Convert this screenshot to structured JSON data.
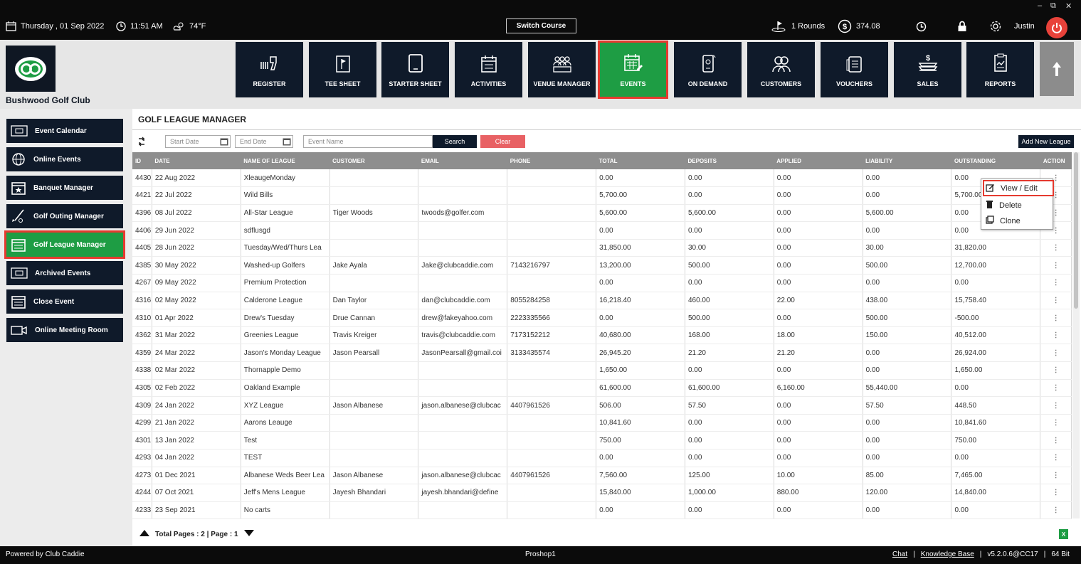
{
  "topbar": {
    "date": "Thursday , 01 Sep 2022",
    "time": "11:51 AM",
    "weather": "74°F",
    "switch_course": "Switch Course",
    "rounds": "1 Rounds",
    "balance": "374.08",
    "user": "Justin"
  },
  "club": {
    "name": "Bushwood Golf Club"
  },
  "nav": [
    {
      "label": "REGISTER",
      "icon": "barcode-scanner-icon"
    },
    {
      "label": "TEE SHEET",
      "icon": "flag-board-icon"
    },
    {
      "label": "STARTER SHEET",
      "icon": "tablet-icon"
    },
    {
      "label": "ACTIVITIES",
      "icon": "calendar-list-icon"
    },
    {
      "label": "VENUE MANAGER",
      "icon": "people-group-icon"
    },
    {
      "label": "EVENTS",
      "icon": "calendar-edit-icon"
    },
    {
      "label": "ON DEMAND",
      "icon": "phone-icon"
    },
    {
      "label": "CUSTOMERS",
      "icon": "customers-icon"
    },
    {
      "label": "VOUCHERS",
      "icon": "voucher-icon"
    },
    {
      "label": "SALES",
      "icon": "cash-icon"
    },
    {
      "label": "REPORTS",
      "icon": "report-icon"
    }
  ],
  "sidebar": [
    {
      "label": "Event Calendar"
    },
    {
      "label": "Online Events"
    },
    {
      "label": "Banquet Manager"
    },
    {
      "label": "Golf Outing Manager"
    },
    {
      "label": "Golf League Manager"
    },
    {
      "label": "Archived Events"
    },
    {
      "label": "Close Event"
    },
    {
      "label": "Online Meeting Room"
    }
  ],
  "main": {
    "title": "GOLF LEAGUE MANAGER",
    "start_placeholder": "Start Date",
    "end_placeholder": "End Date",
    "name_placeholder": "Event Name",
    "search_label": "Search",
    "clear_label": "Clear",
    "add_label": "Add New League",
    "pagination": "Total Pages : 2 | Page : 1",
    "excel": "X"
  },
  "table": {
    "headers": [
      "ID",
      "DATE",
      "NAME OF LEAGUE",
      "CUSTOMER",
      "EMAIL",
      "PHONE",
      "TOTAL",
      "DEPOSITS",
      "APPLIED",
      "LIABILITY",
      "OUTSTANDING",
      "ACTION"
    ],
    "rows": [
      [
        "4430",
        "22 Aug 2022",
        "XleaugeMonday",
        "",
        "",
        "",
        "0.00",
        "0.00",
        "0.00",
        "0.00",
        "0.00",
        "⋮"
      ],
      [
        "4421",
        "22 Jul 2022",
        "Wild Bills",
        "",
        "",
        "",
        "5,700.00",
        "0.00",
        "0.00",
        "0.00",
        "5,700.00",
        "⋮"
      ],
      [
        "4396",
        "08 Jul 2022",
        "All-Star League",
        "Tiger Woods",
        "twoods@golfer.com",
        "",
        "5,600.00",
        "5,600.00",
        "0.00",
        "5,600.00",
        "0.00",
        "⋮"
      ],
      [
        "4406",
        "29 Jun 2022",
        "sdflusgd",
        "",
        "",
        "",
        "0.00",
        "0.00",
        "0.00",
        "0.00",
        "0.00",
        "⋮"
      ],
      [
        "4405",
        "28 Jun 2022",
        "Tuesday/Wed/Thurs Lea",
        "",
        "",
        "",
        "31,850.00",
        "30.00",
        "0.00",
        "30.00",
        "31,820.00",
        "⋮"
      ],
      [
        "4385",
        "30 May 2022",
        "Washed-up Golfers",
        "Jake Ayala",
        "Jake@clubcaddie.com",
        "7143216797",
        "13,200.00",
        "500.00",
        "0.00",
        "500.00",
        "12,700.00",
        "⋮"
      ],
      [
        "4267",
        "09 May 2022",
        "Premium Protection",
        "",
        "",
        "",
        "0.00",
        "0.00",
        "0.00",
        "0.00",
        "0.00",
        "⋮"
      ],
      [
        "4316",
        "02 May 2022",
        "Calderone League",
        "Dan Taylor",
        "dan@clubcaddie.com",
        "8055284258",
        "16,218.40",
        "460.00",
        "22.00",
        "438.00",
        "15,758.40",
        "⋮"
      ],
      [
        "4310",
        "01 Apr 2022",
        "Drew's Tuesday",
        "Drue Cannan",
        "drew@fakeyahoo.com",
        "2223335566",
        "0.00",
        "500.00",
        "0.00",
        "500.00",
        "-500.00",
        "⋮"
      ],
      [
        "4362",
        "31 Mar 2022",
        "Greenies League",
        "Travis Kreiger",
        "travis@clubcaddie.com",
        "7173152212",
        "40,680.00",
        "168.00",
        "18.00",
        "150.00",
        "40,512.00",
        "⋮"
      ],
      [
        "4359",
        "24 Mar 2022",
        "Jason's Monday League",
        "Jason Pearsall",
        "JasonPearsall@gmail.coi",
        "3133435574",
        "26,945.20",
        "21.20",
        "21.20",
        "0.00",
        "26,924.00",
        "⋮"
      ],
      [
        "4338",
        "02 Mar 2022",
        "Thornapple Demo",
        "",
        "",
        "",
        "1,650.00",
        "0.00",
        "0.00",
        "0.00",
        "1,650.00",
        "⋮"
      ],
      [
        "4305",
        "02 Feb 2022",
        "Oakland Example",
        "",
        "",
        "",
        "61,600.00",
        "61,600.00",
        "6,160.00",
        "55,440.00",
        "0.00",
        "⋮"
      ],
      [
        "4309",
        "24 Jan 2022",
        "XYZ League",
        "Jason Albanese",
        "jason.albanese@clubcac",
        "4407961526",
        "506.00",
        "57.50",
        "0.00",
        "57.50",
        "448.50",
        "⋮"
      ],
      [
        "4299",
        "21 Jan 2022",
        "Aarons Leauge",
        "",
        "",
        "",
        "10,841.60",
        "0.00",
        "0.00",
        "0.00",
        "10,841.60",
        "⋮"
      ],
      [
        "4301",
        "13 Jan 2022",
        "Test",
        "",
        "",
        "",
        "750.00",
        "0.00",
        "0.00",
        "0.00",
        "750.00",
        "⋮"
      ],
      [
        "4293",
        "04 Jan 2022",
        "TEST",
        "",
        "",
        "",
        "0.00",
        "0.00",
        "0.00",
        "0.00",
        "0.00",
        "⋮"
      ],
      [
        "4273",
        "01 Dec 2021",
        "Albanese Weds Beer Lea",
        "Jason Albanese",
        "jason.albanese@clubcac",
        "4407961526",
        "7,560.00",
        "125.00",
        "10.00",
        "85.00",
        "7,465.00",
        "⋮"
      ],
      [
        "4244",
        "07 Oct 2021",
        "Jeff's Mens League",
        "Jayesh Bhandari",
        "jayesh.bhandari@define",
        "",
        "15,840.00",
        "1,000.00",
        "880.00",
        "120.00",
        "14,840.00",
        "⋮"
      ],
      [
        "4233",
        "23 Sep 2021",
        "No carts",
        "",
        "",
        "",
        "0.00",
        "0.00",
        "0.00",
        "0.00",
        "0.00",
        "⋮"
      ]
    ]
  },
  "context_menu": {
    "view_edit": "View / Edit",
    "delete": "Delete",
    "clone": "Clone"
  },
  "status": {
    "left": "Powered by Club Caddie",
    "center": "Proshop1",
    "chat": "Chat",
    "kb": "Knowledge Base",
    "version": "v5.2.0.6@CC17",
    "bits": "64 Bit",
    "sep": "|"
  },
  "colors": {
    "navy": "#0f1a2a",
    "active_green": "#1e9d44",
    "highlight_red": "#e53a2f",
    "search_navy": "#0e1a2b",
    "clear_red": "#e86164",
    "power_red": "#e8423a"
  }
}
